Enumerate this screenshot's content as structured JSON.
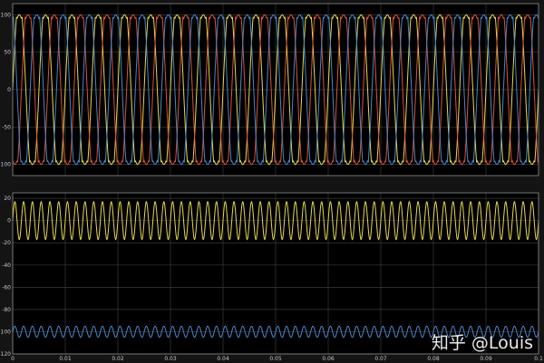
{
  "colors": {
    "background": "#141414",
    "plot_bg": "#000000",
    "grid": "#3a3a3a",
    "frame": "#8c8c8c",
    "tick_text": "#c8c8c8",
    "yellow": "#e7d84c",
    "red": "#d9533a",
    "blue": "#4a86c8"
  },
  "watermark": "知乎 @Louis",
  "chart_data": [
    {
      "type": "line",
      "title": "",
      "xlabel": "",
      "ylabel": "",
      "xlim": [
        0,
        0.1
      ],
      "ylim": [
        -115,
        115
      ],
      "grid": true,
      "y_ticks": [
        -100,
        -50,
        0,
        50,
        100
      ],
      "y_tick_labels": [
        "-100",
        "-50",
        "0",
        "50",
        "100"
      ],
      "x_ticks": [
        0,
        0.01,
        0.02,
        0.03,
        0.04,
        0.05,
        0.06,
        0.07,
        0.08,
        0.09,
        0.1
      ],
      "x_tick_labels": [],
      "waveform": {
        "shape": "three-phase clipped sine (flat tops with ripple)",
        "frequency_hz": 200,
        "peak": 100,
        "phase_shift_deg": 120
      },
      "series": [
        {
          "color": "yellow",
          "phase_deg": 0
        },
        {
          "color": "red",
          "phase_deg": -120
        },
        {
          "color": "blue",
          "phase_deg": 120
        }
      ]
    },
    {
      "type": "line",
      "title": "",
      "xlabel": "",
      "ylabel": "",
      "xlim": [
        0,
        0.1
      ],
      "ylim": [
        -120,
        25
      ],
      "grid": true,
      "y_ticks": [
        -120,
        -100,
        -80,
        -60,
        -40,
        -20,
        0,
        20
      ],
      "y_tick_labels": [
        "-120",
        "-100",
        "-80",
        "-60",
        "-40",
        "-20",
        "0",
        "20"
      ],
      "x_ticks": [
        0,
        0.01,
        0.02,
        0.03,
        0.04,
        0.05,
        0.06,
        0.07,
        0.08,
        0.09,
        0.1
      ],
      "x_tick_labels": [
        "0",
        "0.01",
        "0.02",
        "0.03",
        "0.04",
        "0.05",
        "0.06",
        "0.07",
        "0.08",
        "0.09",
        "0.1"
      ],
      "series": [
        {
          "color": "yellow",
          "waveform": "sine",
          "mean": 0,
          "amplitude": 17,
          "frequency_hz": 600
        },
        {
          "color": "blue",
          "waveform": "sine",
          "mean": -100,
          "amplitude": 5,
          "frequency_hz": 600
        }
      ]
    }
  ]
}
